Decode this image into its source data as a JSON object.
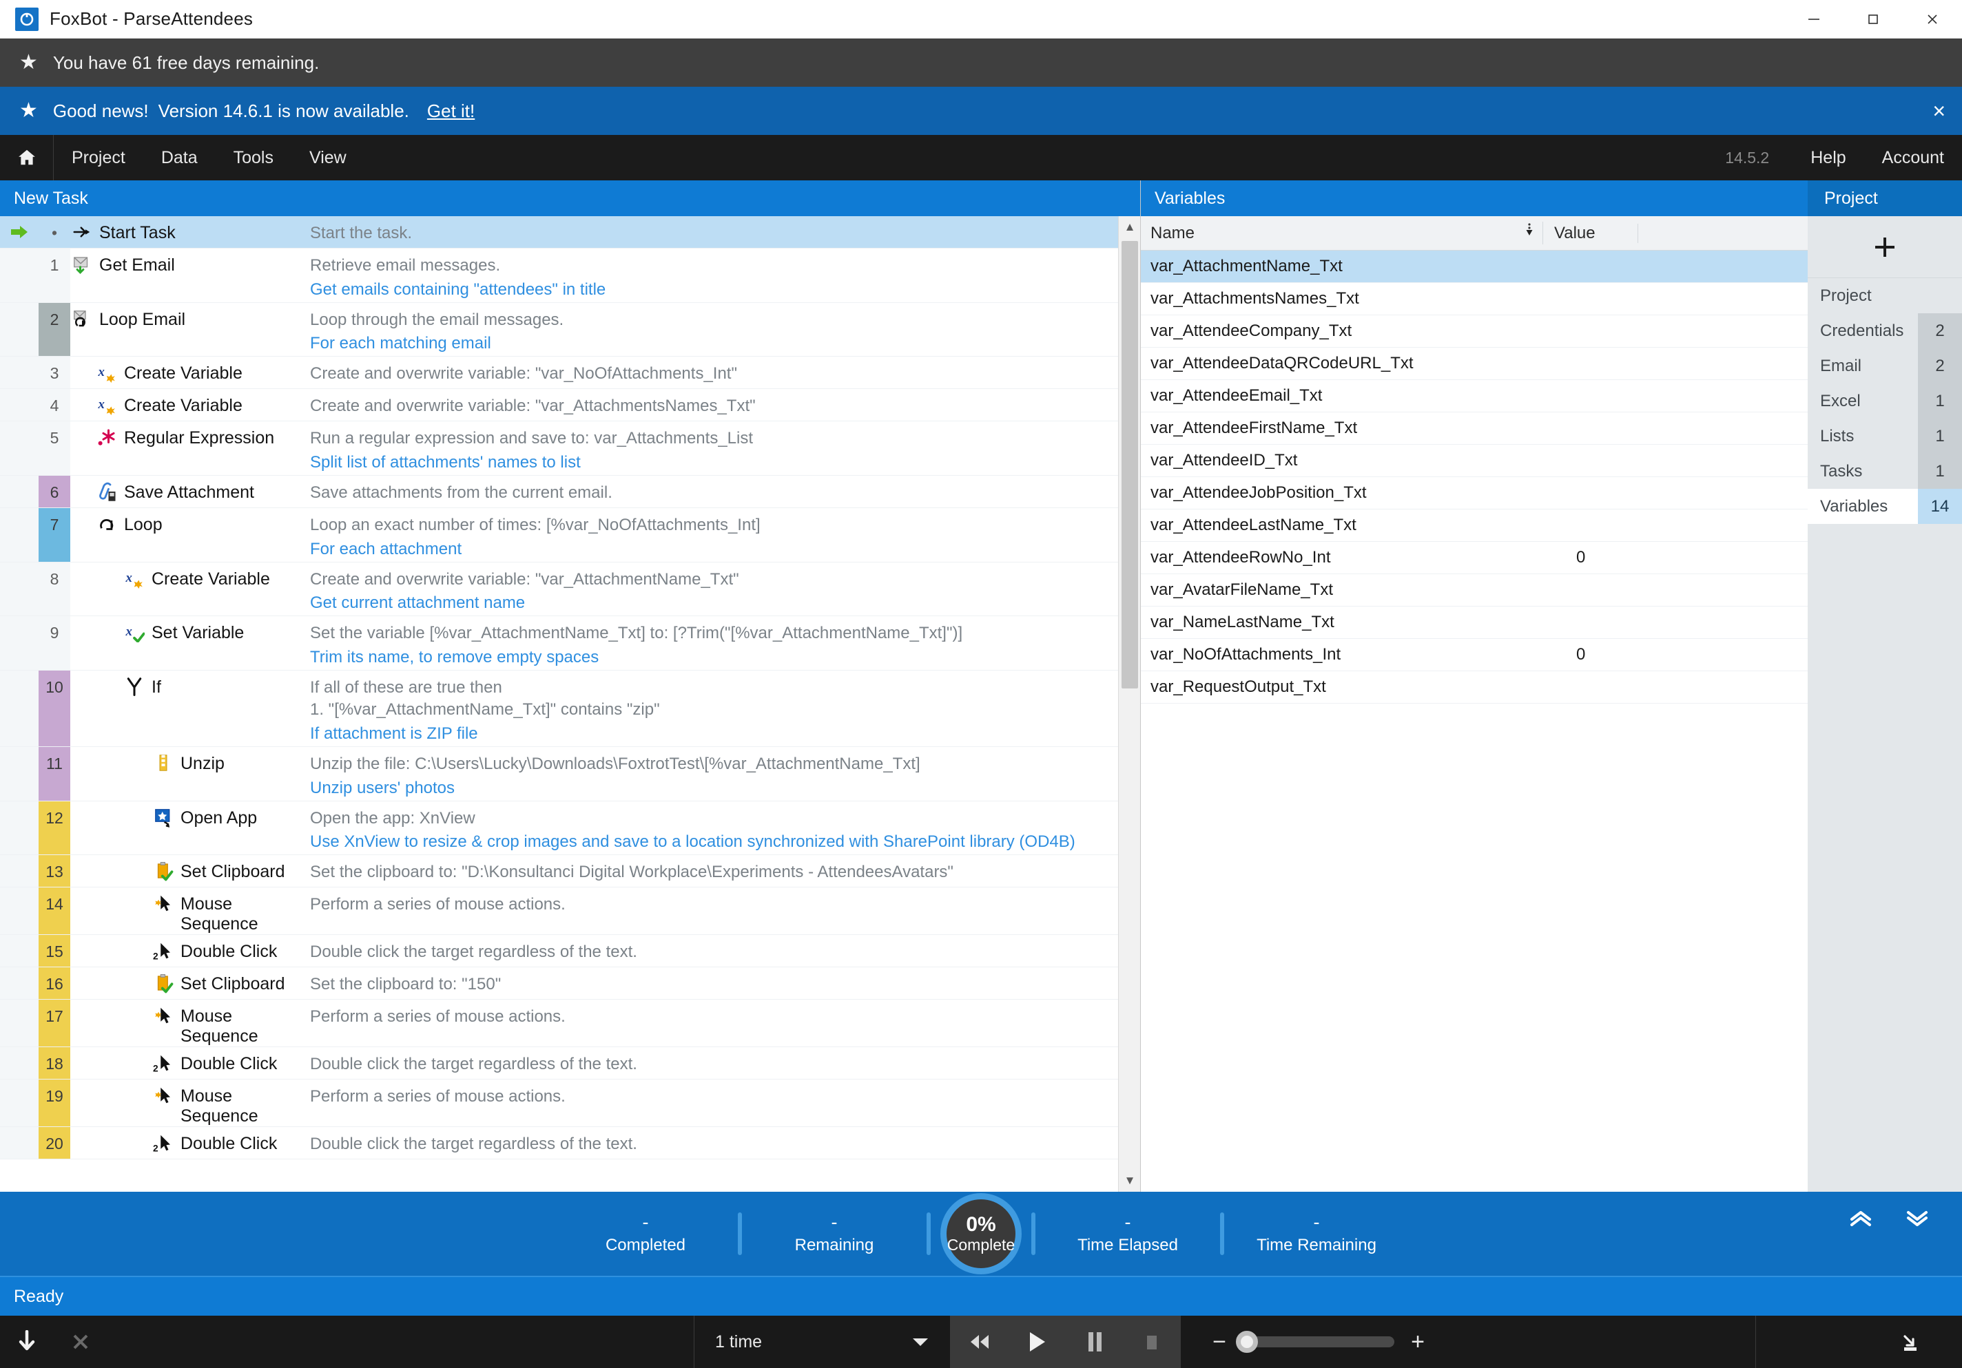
{
  "window": {
    "app_name": "FoxBot",
    "separator": "-",
    "document_name": "ParseAttendees",
    "title": "FoxBot  -  ParseAttendees",
    "controls": {
      "minimize": "minimize-icon",
      "maximize": "maximize-icon",
      "close": "close-icon"
    }
  },
  "banners": {
    "trial": {
      "icon": "star-icon",
      "text": "You have 61 free days remaining."
    },
    "update": {
      "icon": "star-icon",
      "lead": "Good news!",
      "text": "Version 14.6.1 is now available.",
      "link": "Get it!",
      "close": "×"
    }
  },
  "menubar": {
    "home_icon": "home-icon",
    "items": [
      "Project",
      "Data",
      "Tools",
      "View"
    ],
    "version": "14.5.2",
    "right_items": [
      "Help",
      "Account"
    ]
  },
  "task_panel": {
    "header": "New Task",
    "rows": [
      {
        "num": "•",
        "band": "none",
        "indent": 0,
        "icon": "start-task-icon",
        "name": "Start Task",
        "desc": "Start the task.",
        "note": "",
        "selected": true,
        "arrow": true
      },
      {
        "num": "1",
        "band": "none",
        "indent": 0,
        "icon": "get-email-icon",
        "name": "Get Email",
        "desc": "Retrieve email messages.",
        "note": "Get emails containing \"attendees\" in title"
      },
      {
        "num": "2",
        "band": "gray",
        "indent": 0,
        "icon": "loop-email-icon",
        "name": "Loop Email",
        "desc": "Loop through the email messages.",
        "note": "For each matching email"
      },
      {
        "num": "3",
        "band": "none",
        "indent": 1,
        "icon": "create-variable-icon",
        "name": "Create Variable",
        "desc": "Create and overwrite variable: \"var_NoOfAttachments_Int\"",
        "note": ""
      },
      {
        "num": "4",
        "band": "none",
        "indent": 1,
        "icon": "create-variable-icon",
        "name": "Create Variable",
        "desc": "Create and overwrite variable: \"var_AttachmentsNames_Txt\"",
        "note": ""
      },
      {
        "num": "5",
        "band": "none",
        "indent": 1,
        "icon": "regex-icon",
        "name": "Regular Expression",
        "desc": "Run a regular expression and save to: var_Attachments_List",
        "note": "Split list of attachments' names to list"
      },
      {
        "num": "6",
        "band": "purple",
        "indent": 1,
        "icon": "save-attachment-icon",
        "name": "Save Attachment",
        "desc": "Save attachments from the current email.",
        "note": ""
      },
      {
        "num": "7",
        "band": "blue",
        "indent": 1,
        "icon": "loop-icon",
        "name": "Loop",
        "desc": "Loop an exact number of times: [%var_NoOfAttachments_Int]",
        "note": "For each attachment"
      },
      {
        "num": "8",
        "band": "none",
        "indent": 2,
        "icon": "create-variable-icon",
        "name": "Create Variable",
        "desc": "Create and overwrite variable: \"var_AttachmentName_Txt\"",
        "note": "Get current attachment name"
      },
      {
        "num": "9",
        "band": "none",
        "indent": 2,
        "icon": "set-variable-icon",
        "name": "Set Variable",
        "desc": "Set the variable [%var_AttachmentName_Txt] to: [?Trim(\"[%var_AttachmentName_Txt]\")]",
        "note": "Trim its name, to remove empty spaces"
      },
      {
        "num": "10",
        "band": "purple",
        "indent": 2,
        "icon": "if-icon",
        "name": "If",
        "desc": "If all of these are true then",
        "desc2": "1. \"[%var_AttachmentName_Txt]\" contains \"zip\"",
        "note": "If attachment is ZIP file"
      },
      {
        "num": "11",
        "band": "purple",
        "indent": 3,
        "icon": "unzip-icon",
        "name": "Unzip",
        "desc": "Unzip the file: C:\\Users\\Lucky\\Downloads\\FoxtrotTest\\[%var_AttachmentName_Txt]",
        "note": "Unzip users' photos"
      },
      {
        "num": "12",
        "band": "yellow",
        "indent": 3,
        "icon": "open-app-icon",
        "name": "Open App",
        "desc": "Open the app: XnView",
        "note": "Use XnView to resize & crop images and save to a location synchronized with SharePoint library (OD4B)"
      },
      {
        "num": "13",
        "band": "yellow",
        "indent": 3,
        "icon": "set-clipboard-icon",
        "name": "Set Clipboard",
        "desc": "Set the clipboard to: \"D:\\Konsultanci Digital Workplace\\Experiments - AttendeesAvatars\"",
        "note": ""
      },
      {
        "num": "14",
        "band": "yellow",
        "indent": 3,
        "icon": "mouse-sequence-icon",
        "name": "Mouse Sequence",
        "desc": "Perform a series of mouse actions.",
        "note": ""
      },
      {
        "num": "15",
        "band": "yellow",
        "indent": 3,
        "icon": "double-click-icon",
        "name": "Double Click",
        "desc": "Double click the target regardless of the text.",
        "note": ""
      },
      {
        "num": "16",
        "band": "yellow",
        "indent": 3,
        "icon": "set-clipboard-icon",
        "name": "Set Clipboard",
        "desc": "Set the clipboard to: \"150\"",
        "note": ""
      },
      {
        "num": "17",
        "band": "yellow",
        "indent": 3,
        "icon": "mouse-sequence-icon",
        "name": "Mouse Sequence",
        "desc": "Perform a series of mouse actions.",
        "note": ""
      },
      {
        "num": "18",
        "band": "yellow",
        "indent": 3,
        "icon": "double-click-icon",
        "name": "Double Click",
        "desc": "Double click the target regardless of the text.",
        "note": ""
      },
      {
        "num": "19",
        "band": "yellow",
        "indent": 3,
        "icon": "mouse-sequence-icon",
        "name": "Mouse Sequence",
        "desc": "Perform a series of mouse actions.",
        "note": ""
      },
      {
        "num": "20",
        "band": "yellow",
        "indent": 3,
        "icon": "double-click-icon",
        "name": "Double Click",
        "desc": "Double click the target regardless of the text.",
        "note": ""
      }
    ]
  },
  "variables_panel": {
    "header": "Variables",
    "columns": [
      "Name",
      "Value"
    ],
    "sort_icon": "sort-icon",
    "rows": [
      {
        "name": "var_AttachmentName_Txt",
        "value": "",
        "selected": true
      },
      {
        "name": "var_AttachmentsNames_Txt",
        "value": ""
      },
      {
        "name": "var_AttendeeCompany_Txt",
        "value": ""
      },
      {
        "name": "var_AttendeeDataQRCodeURL_Txt",
        "value": ""
      },
      {
        "name": "var_AttendeeEmail_Txt",
        "value": ""
      },
      {
        "name": "var_AttendeeFirstName_Txt",
        "value": ""
      },
      {
        "name": "var_AttendeeID_Txt",
        "value": ""
      },
      {
        "name": "var_AttendeeJobPosition_Txt",
        "value": ""
      },
      {
        "name": "var_AttendeeLastName_Txt",
        "value": ""
      },
      {
        "name": "var_AttendeeRowNo_Int",
        "value": "0"
      },
      {
        "name": "var_AvatarFileName_Txt",
        "value": ""
      },
      {
        "name": "var_NameLastName_Txt",
        "value": ""
      },
      {
        "name": "var_NoOfAttachments_Int",
        "value": "0"
      },
      {
        "name": "var_RequestOutput_Txt",
        "value": ""
      }
    ]
  },
  "project_panel": {
    "header": "Project",
    "add_icon": "plus-icon",
    "items": [
      {
        "label": "Project",
        "count": "",
        "active": false
      },
      {
        "label": "Credentials",
        "count": "2",
        "active": false
      },
      {
        "label": "Email",
        "count": "2",
        "active": false
      },
      {
        "label": "Excel",
        "count": "1",
        "active": false
      },
      {
        "label": "Lists",
        "count": "1",
        "active": false
      },
      {
        "label": "Tasks",
        "count": "1",
        "active": false
      },
      {
        "label": "Variables",
        "count": "14",
        "active": true
      }
    ]
  },
  "progress": {
    "completed": {
      "value": "-",
      "label": "Completed"
    },
    "remaining": {
      "value": "-",
      "label": "Remaining"
    },
    "donut": {
      "percent": "0%",
      "label": "Complete"
    },
    "time_elapsed": {
      "value": "-",
      "label": "Time Elapsed"
    },
    "time_remaining": {
      "value": "-",
      "label": "Time Remaining"
    },
    "collapse_up_icon": "chevron-double-up-icon",
    "collapse_down_icon": "chevron-double-down-icon"
  },
  "statusbar": {
    "text": "Ready"
  },
  "bottombar": {
    "step_into_icon": "arrow-down-icon",
    "stop_x_icon": "close-x-icon",
    "repeat_value": "1 time",
    "repeat_caret": "chevron-down-icon",
    "rewind_icon": "rewind-icon",
    "play_icon": "play-icon",
    "pause_icon": "pause-icon",
    "stop_icon": "stop-icon",
    "zoom_out": "−",
    "zoom_in": "+",
    "minimize_to_tray_icon": "arrow-into-tray-icon"
  }
}
